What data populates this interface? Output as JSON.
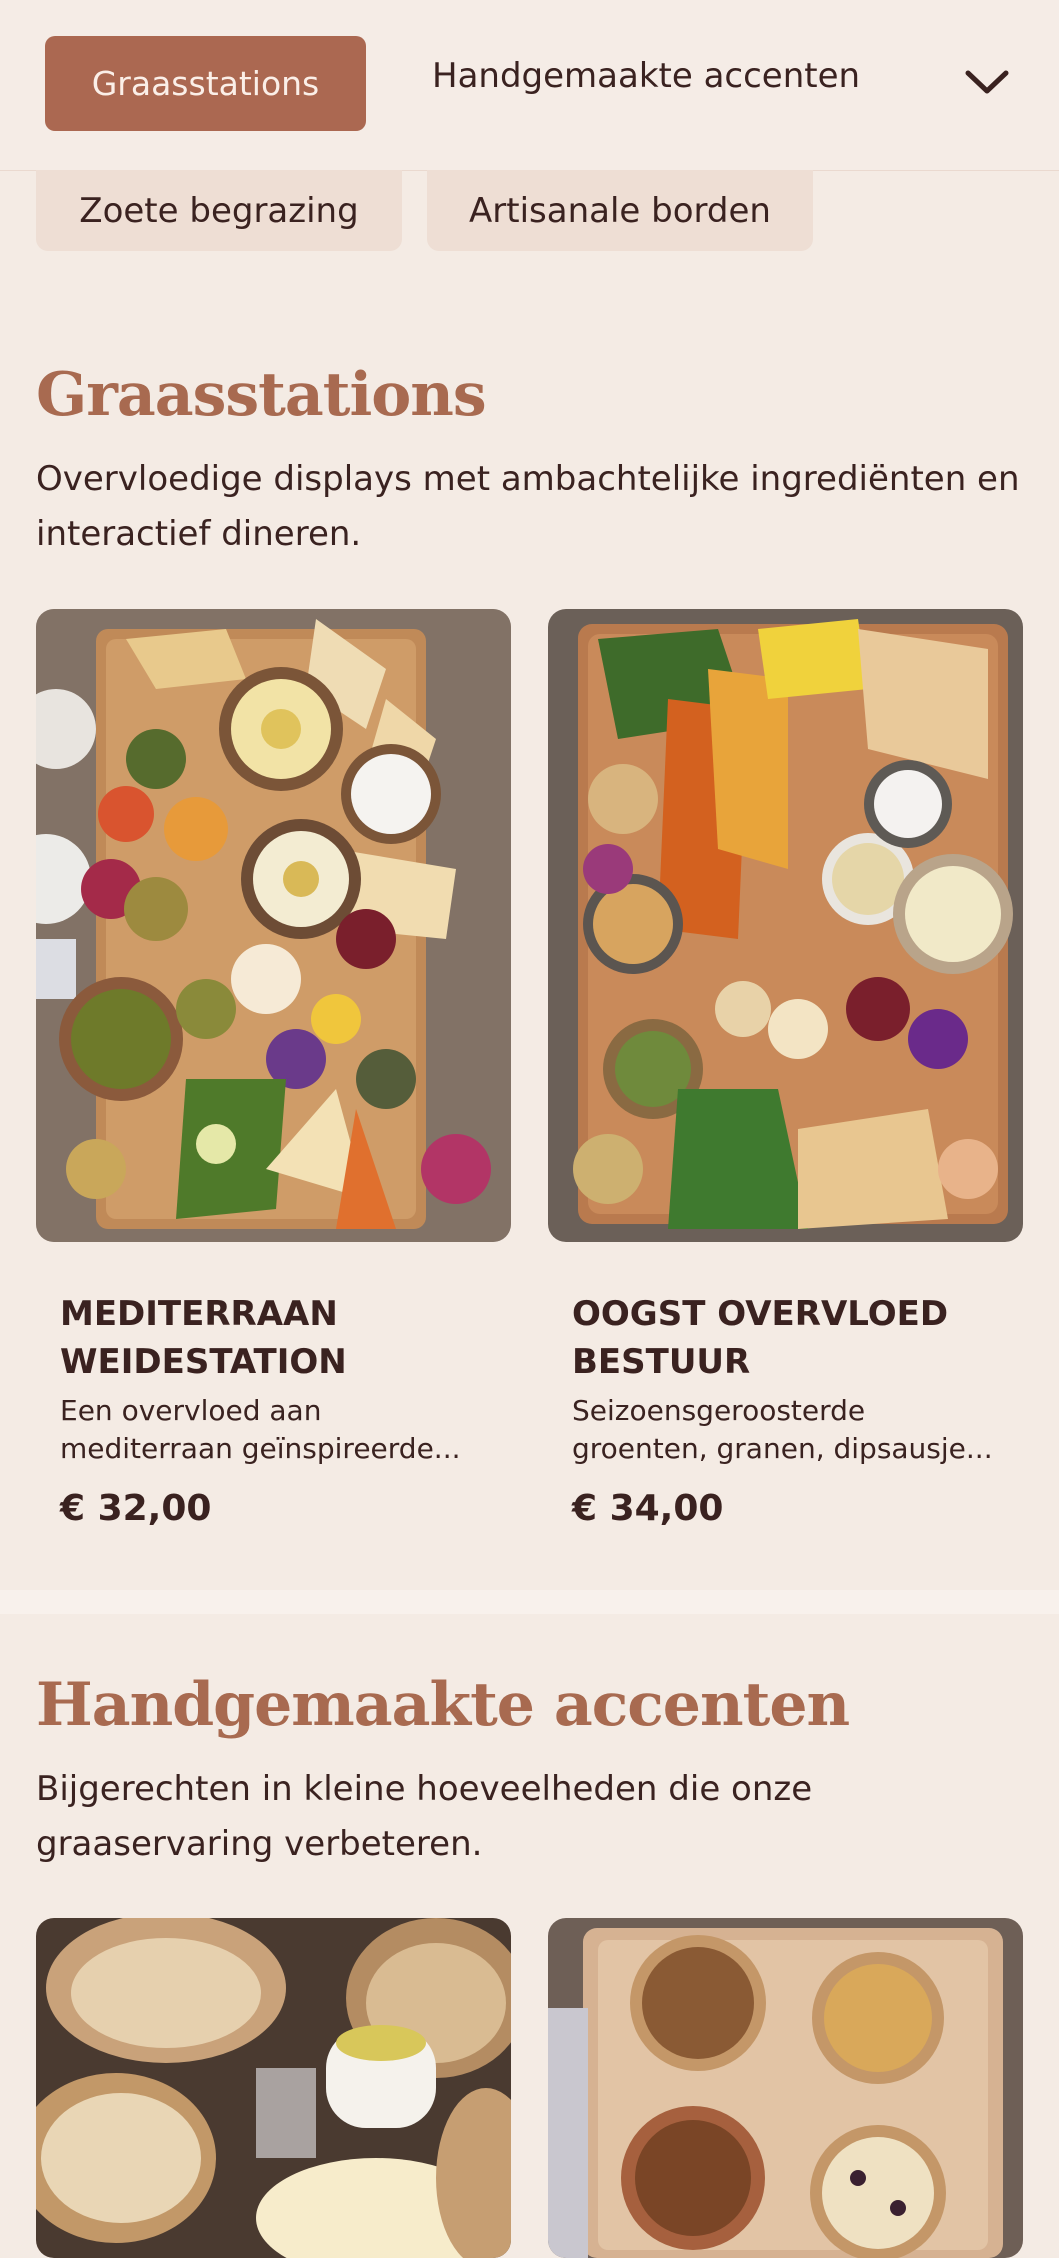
{
  "nav": {
    "active_chip": "Graasstations",
    "chip_handgemaakt": "Handgemaakte accenten",
    "chip_zoete": "Zoete begrazing",
    "chip_artisanale": "Artisanale borden"
  },
  "sections": [
    {
      "title": "Graasstations",
      "description": "Overvloedige displays met ambachtelijke ingrediënten en interactief dineren.",
      "products": [
        {
          "title": "MEDITERRAAN WEIDESTATION",
          "description": "Een overvloed aan mediterraan geïnspireerde...",
          "price": "€ 32,00"
        },
        {
          "title": "OOGST OVERVLOED BESTUUR",
          "description": "Seizoensgeroosterde groenten, granen, dipsausje...",
          "price": "€ 34,00"
        }
      ]
    },
    {
      "title": "Handgemaakte accenten",
      "description": "Bijgerechten in kleine hoeveelheden die onze graaservaring verbeteren."
    }
  ],
  "colors": {
    "accent": "#ab6851",
    "heading": "#a86a50",
    "background": "#f4ebe4",
    "text": "#3a2220"
  }
}
